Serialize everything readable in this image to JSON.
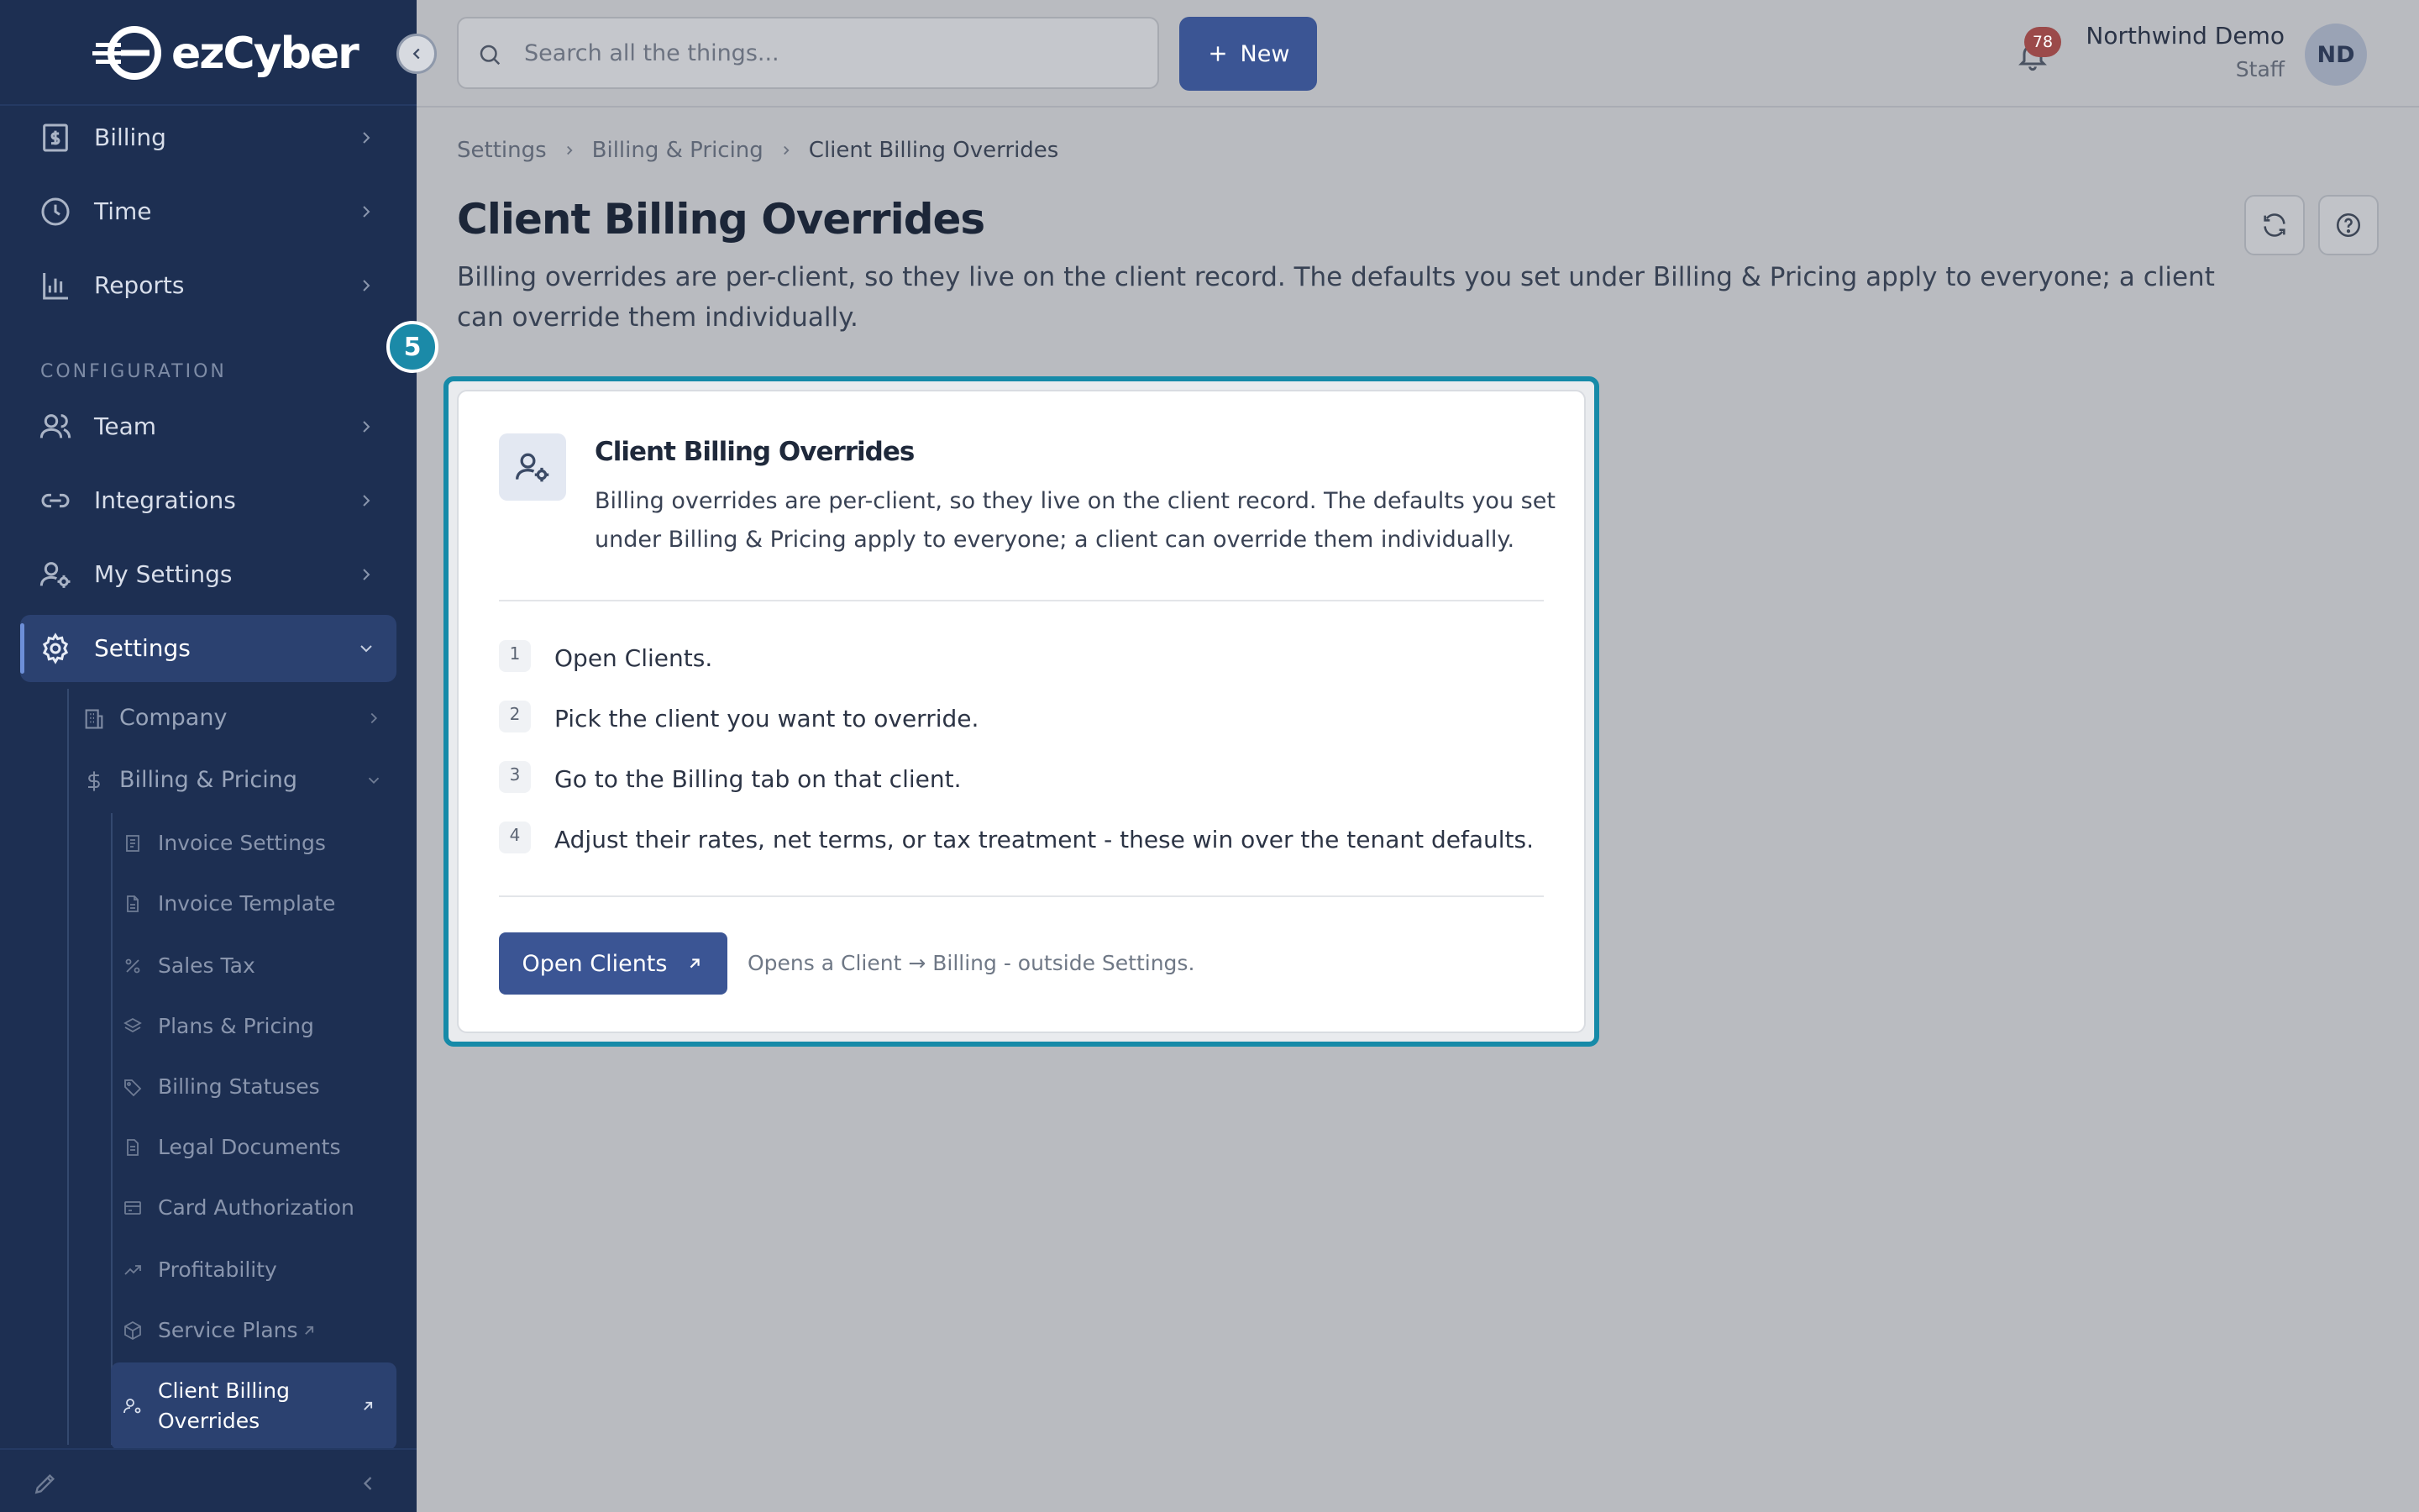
{
  "brand": {
    "name_left": "ez",
    "name_right": "Cyber",
    "accent": "#1d2f52"
  },
  "sidebar": {
    "items_top": [
      {
        "label": "Billing",
        "icon": "receipt-icon"
      },
      {
        "label": "Time",
        "icon": "clock-icon"
      },
      {
        "label": "Reports",
        "icon": "bar-chart-icon"
      }
    ],
    "config_heading": "CONFIGURATION",
    "items_config": [
      {
        "label": "Team",
        "icon": "users-icon"
      },
      {
        "label": "Integrations",
        "icon": "link-icon"
      },
      {
        "label": "My Settings",
        "icon": "user-cog-icon"
      },
      {
        "label": "Settings",
        "icon": "gear-icon",
        "active": true
      }
    ],
    "settings_children": [
      {
        "label": "Company",
        "icon": "building-icon"
      },
      {
        "label": "Billing & Pricing",
        "icon": "dollar-icon",
        "expanded": true
      }
    ],
    "billing_children": [
      {
        "label": "Invoice Settings",
        "icon": "invoice-icon"
      },
      {
        "label": "Invoice Template",
        "icon": "file-icon"
      },
      {
        "label": "Sales Tax",
        "icon": "percent-icon"
      },
      {
        "label": "Plans & Pricing",
        "icon": "layers-icon"
      },
      {
        "label": "Billing Statuses",
        "icon": "tag-icon"
      },
      {
        "label": "Legal Documents",
        "icon": "document-icon"
      },
      {
        "label": "Card Authorization",
        "icon": "card-icon"
      },
      {
        "label": "Profitability",
        "icon": "trend-icon"
      },
      {
        "label": "Service Plans",
        "icon": "box-icon",
        "external": true
      },
      {
        "label": "Client Billing Overrides",
        "icon": "user-cog-icon",
        "external": true,
        "active": true
      }
    ]
  },
  "topbar": {
    "search_placeholder": "Search all the things...",
    "new_label": "New",
    "notification_count": "78",
    "user_name": "Northwind Demo",
    "user_role": "Staff",
    "avatar_initials": "ND"
  },
  "breadcrumb": [
    "Settings",
    "Billing & Pricing",
    "Client Billing Overrides"
  ],
  "page": {
    "title": "Client Billing Overrides",
    "description": "Billing overrides are per-client, so they live on the client record. The defaults you set under Billing & Pricing apply to everyone; a client can override them individually."
  },
  "tour": {
    "step_number": "5",
    "highlight_color": "#168aa8"
  },
  "card": {
    "title": "Client Billing Overrides",
    "description": "Billing overrides are per-client, so they live on the client record. The defaults you set under Billing & Pricing apply to everyone; a client can override them individually.",
    "steps": [
      {
        "num": "1",
        "text": "Open Clients."
      },
      {
        "num": "2",
        "text": "Pick the client you want to override."
      },
      {
        "num": "3",
        "text": "Go to the Billing tab on that client."
      },
      {
        "num": "4",
        "text": "Adjust their rates, net terms, or tax treatment - these win over the tenant defaults."
      }
    ],
    "button_label": "Open Clients",
    "footer_note": "Opens a Client → Billing - outside Settings."
  }
}
